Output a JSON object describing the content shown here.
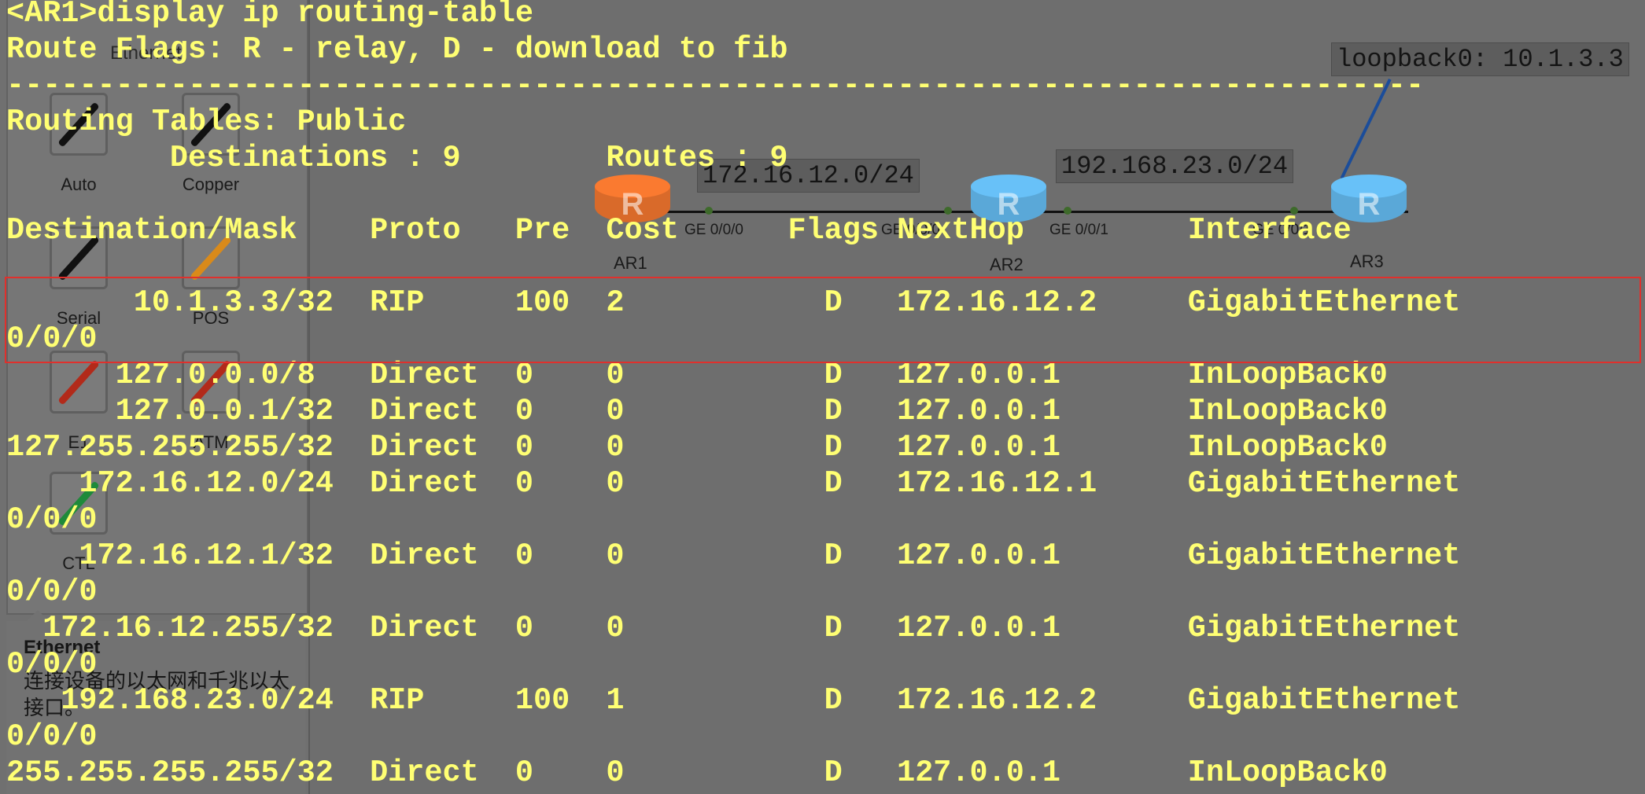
{
  "background": {
    "panel_tab_title": "Ethernet",
    "cables": [
      {
        "label": "Auto",
        "color": "#111111"
      },
      {
        "label": "Copper",
        "color": "#111111"
      },
      {
        "label": "Serial",
        "color": "#111111"
      },
      {
        "label": "POS",
        "color": "#d98a1a"
      },
      {
        "label": "E1",
        "color": "#b22a1a"
      },
      {
        "label": "ATM",
        "color": "#b22a1a"
      },
      {
        "label": "CTL",
        "color": "#1e8a3a"
      }
    ],
    "description": {
      "title": "Ethernet",
      "text": "连接设备的以太网和千兆以太接口。"
    },
    "topology": {
      "routers": [
        {
          "name": "AR1",
          "color": "#d96a2a"
        },
        {
          "name": "AR2",
          "color": "#5aa8d8"
        },
        {
          "name": "AR3",
          "color": "#5aa8d8"
        }
      ],
      "networks": [
        "172.16.12.0/24",
        "192.168.23.0/24",
        "loopback0: 10.1.3.3"
      ],
      "ports": [
        "GE 0/0/0",
        "GE 0/0/0",
        "GE 0/0/1",
        "GE 0/0/1"
      ]
    }
  },
  "terminal": {
    "text_color": "#ffff73",
    "lines": [
      "<AR1>display ip routing-table",
      "Route Flags: R - relay, D - download to fib",
      "------------------------------------------------------------------------------",
      "Routing Tables: Public",
      "         Destinations : 9        Routes : 9",
      "",
      "Destination/Mask    Proto   Pre  Cost      Flags NextHop         Interface",
      "",
      "       10.1.3.3/32  RIP     100  2           D   172.16.12.2     GigabitEthernet",
      "0/0/0",
      "      127.0.0.0/8   Direct  0    0           D   127.0.0.1       InLoopBack0",
      "      127.0.0.1/32  Direct  0    0           D   127.0.0.1       InLoopBack0",
      "127.255.255.255/32  Direct  0    0           D   127.0.0.1       InLoopBack0",
      "    172.16.12.0/24  Direct  0    0           D   172.16.12.1     GigabitEthernet",
      "0/0/0",
      "    172.16.12.1/32  Direct  0    0           D   127.0.0.1       GigabitEthernet",
      "0/0/0",
      "  172.16.12.255/32  Direct  0    0           D   127.0.0.1       GigabitEthernet",
      "0/0/0",
      "   192.168.23.0/24  RIP     100  1           D   172.16.12.2     GigabitEthernet",
      "0/0/0",
      "255.255.255.255/32  Direct  0    0           D   127.0.0.1       InLoopBack0"
    ]
  }
}
